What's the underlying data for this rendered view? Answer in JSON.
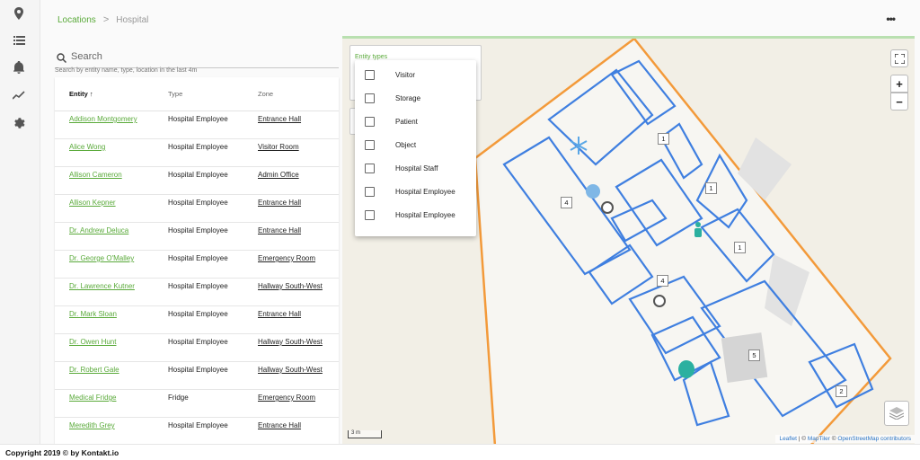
{
  "rail": {
    "items": [
      {
        "icon": "location-pin-icon"
      },
      {
        "icon": "list-icon"
      },
      {
        "icon": "bell-icon"
      },
      {
        "icon": "trend-icon"
      },
      {
        "icon": "gear-icon"
      }
    ]
  },
  "breadcrumb": {
    "parent": "Locations",
    "separator": ">",
    "current": "Hospital"
  },
  "header": {
    "more": "•••"
  },
  "search": {
    "placeholder": "Search",
    "hint": "Search by entity name, type, location in the last 4m"
  },
  "table": {
    "headers": {
      "entity": "Entity ↑",
      "type": "Type",
      "zone": "Zone"
    },
    "rows": [
      {
        "entity": "Addison Montgomery",
        "type": "Hospital Employee",
        "zone": "Entrance Hall"
      },
      {
        "entity": "Alice Wong",
        "type": "Hospital Employee",
        "zone": "Visitor Room"
      },
      {
        "entity": "Allison Cameron",
        "type": "Hospital Employee",
        "zone": "Admin Office"
      },
      {
        "entity": "Allison Kepner",
        "type": "Hospital Employee",
        "zone": "Entrance Hall"
      },
      {
        "entity": "Dr. Andrew Deluca",
        "type": "Hospital Employee",
        "zone": "Entrance Hall"
      },
      {
        "entity": "Dr. George O'Malley",
        "type": "Hospital Employee",
        "zone": "Emergency Room"
      },
      {
        "entity": "Dr. Lawrence Kutner",
        "type": "Hospital Employee",
        "zone": "Hallway South-West"
      },
      {
        "entity": "Dr. Mark Sloan",
        "type": "Hospital Employee",
        "zone": "Entrance Hall"
      },
      {
        "entity": "Dr. Owen Hunt",
        "type": "Hospital Employee",
        "zone": "Hallway South-West"
      },
      {
        "entity": "Dr. Robert Gale",
        "type": "Hospital Employee",
        "zone": "Hallway South-West"
      },
      {
        "entity": "Medical Fridge",
        "type": "Fridge",
        "zone": "Emergency Room"
      },
      {
        "entity": "Meredith Grey",
        "type": "Hospital Employee",
        "zone": "Entrance Hall"
      }
    ]
  },
  "filter": {
    "label": "Entity types",
    "options": [
      "Visitor",
      "Storage",
      "Patient",
      "Object",
      "Hospital Staff",
      "Hospital Employee",
      "Hospital Employee"
    ]
  },
  "map": {
    "zoom_in": "+",
    "zoom_out": "−",
    "scale": "3 m",
    "attribution": {
      "leaflet": "Leaflet",
      "sep1": " | © ",
      "maptiler": "MapTiler",
      "sep2": " © ",
      "osm": "OpenStreetMap contributors"
    },
    "zone_counts": [
      "1",
      "1",
      "1",
      "4",
      "4",
      "5",
      "2"
    ],
    "colors": {
      "walls": "#3f7fe0",
      "boundary": "#f39a3a",
      "accent": "#5aaa3a"
    }
  },
  "footer": {
    "copyright": "Copyright 2019 © by Kontakt.io"
  }
}
